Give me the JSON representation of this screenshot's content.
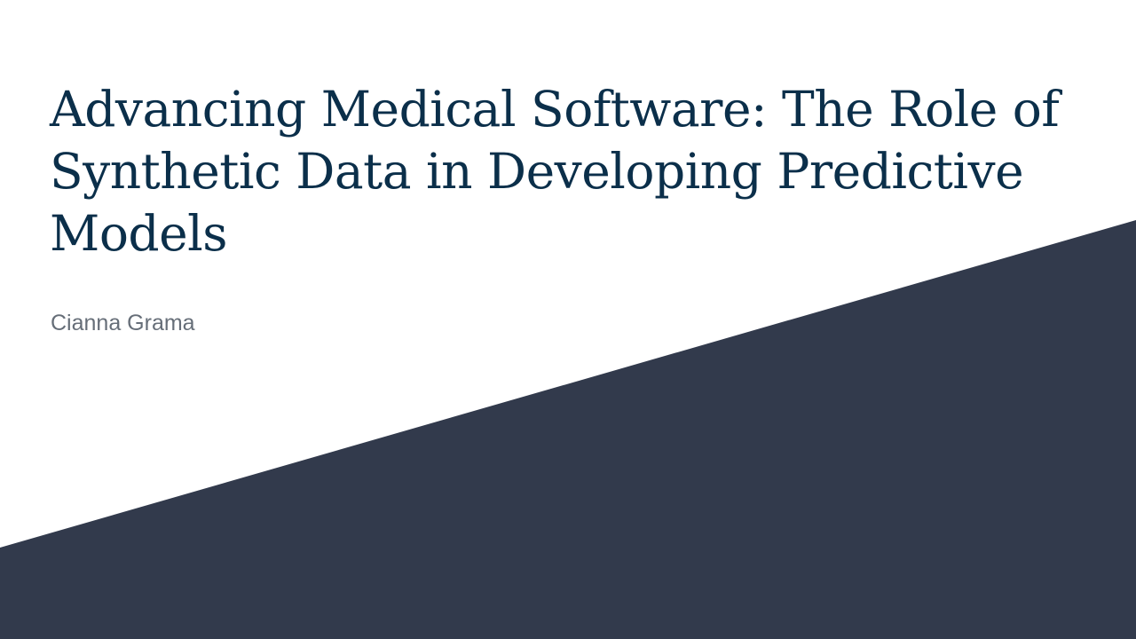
{
  "slide": {
    "title": "Advancing Medical Software: The Role of Synthetic Data in Developing Predictive Models",
    "subtitle": "Cianna Grama"
  },
  "colors": {
    "background": "#ffffff",
    "accent_band": "#323a4c",
    "title": "#0b2f4a",
    "subtitle": "#666e78"
  }
}
